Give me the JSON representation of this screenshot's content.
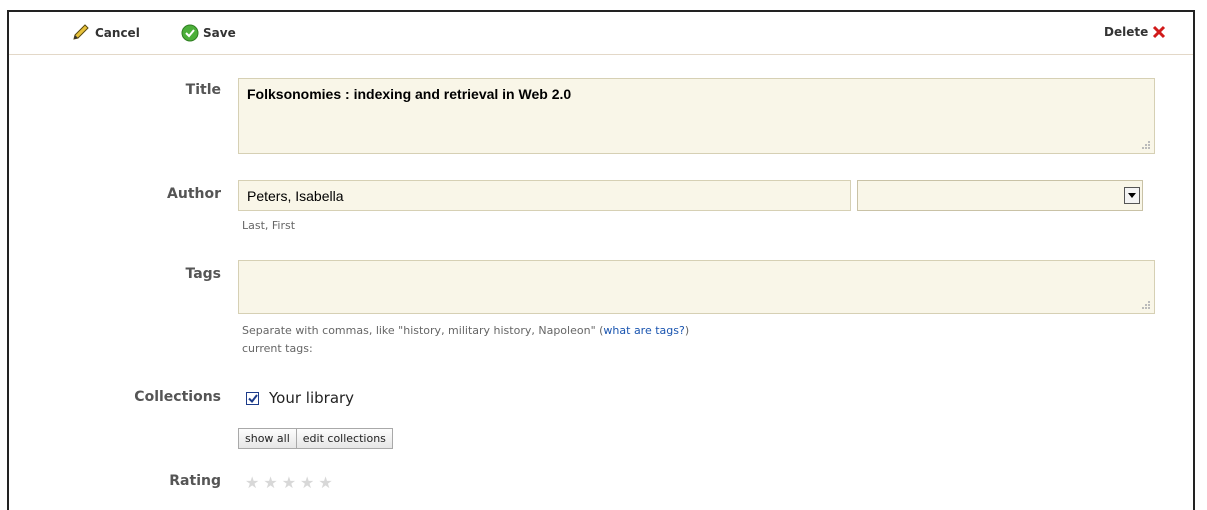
{
  "toolbar": {
    "cancel_label": "Cancel",
    "save_label": "Save",
    "delete_label": "Delete"
  },
  "form": {
    "title_label": "Title",
    "title_value": "Folksonomies : indexing and retrieval in Web 2.0",
    "author_label": "Author",
    "author_value": "Peters, Isabella",
    "author_hint": "Last, First",
    "author_role_value": "",
    "tags_label": "Tags",
    "tags_value": "",
    "tags_hint_prefix": "Separate with commas, like \"history, military history, Napoleon\" (",
    "tags_hint_link": "what are tags?",
    "tags_hint_suffix": ")",
    "current_tags_label": "current tags:",
    "collections_label": "Collections",
    "collection_item": "Your library",
    "collection_checked": true,
    "show_all_label": "show all",
    "edit_collections_label": "edit collections",
    "rating_label": "Rating",
    "rating_value": 0,
    "rating_max": 5
  },
  "colors": {
    "field_bg": "#f9f6e8",
    "field_border": "#d6d0b4",
    "link": "#1a55b0",
    "save_green": "#4caf3a",
    "delete_red": "#d11a1a"
  },
  "icons": [
    "pencil-icon",
    "checkmark-circle-icon",
    "x-icon",
    "dropdown-arrow-icon",
    "checkbox-check-icon",
    "star-icon"
  ]
}
